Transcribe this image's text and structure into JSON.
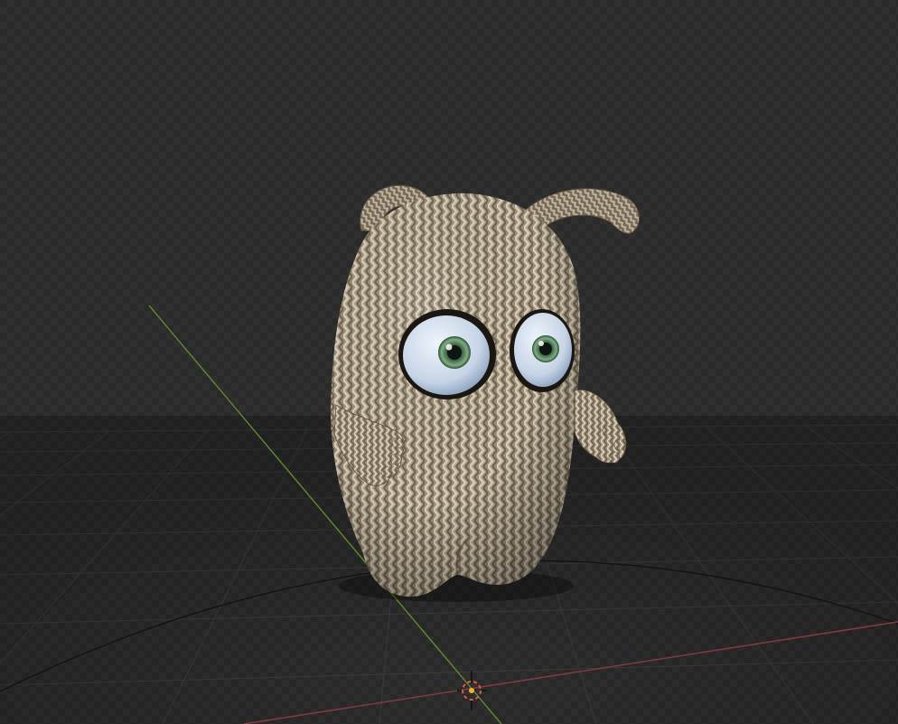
{
  "viewport": {
    "shading": "material-preview",
    "object": "knitted-monster-model",
    "colors": {
      "background": "#2a2a2a",
      "checker": "#303030",
      "grid_line": "#3b3b3b",
      "x_axis": "#8a3a44",
      "y_axis": "#5f8a2c",
      "knit_light": "#d8ccb4",
      "knit_dark": "#7a6c58",
      "iris": "#5f8c62",
      "sclera": "#cfdceb",
      "cursor_ring": "#e05a4a",
      "cursor_core": "#f4b030"
    }
  }
}
